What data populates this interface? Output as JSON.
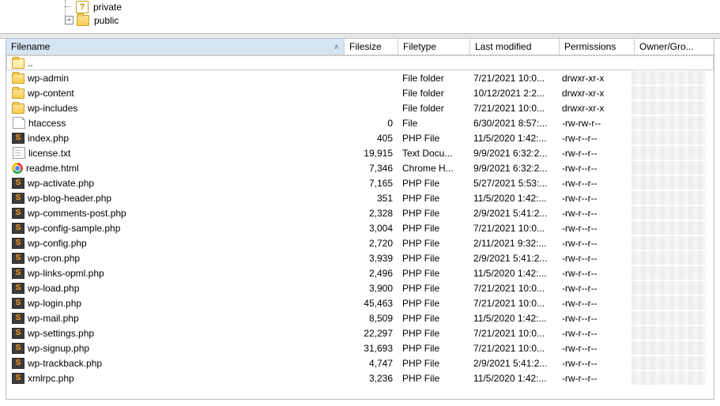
{
  "tree": {
    "items": [
      {
        "label": "private"
      },
      {
        "label": "public"
      }
    ]
  },
  "columns": [
    "Filename",
    "Filesize",
    "Filetype",
    "Last modified",
    "Permissions",
    "Owner/Gro..."
  ],
  "files": [
    {
      "icon": "up",
      "name": "..",
      "size": "",
      "type": "",
      "modified": "",
      "perm": "",
      "owner": "",
      "up": true
    },
    {
      "icon": "folder",
      "name": "wp-admin",
      "size": "",
      "type": "File folder",
      "modified": "7/21/2021 10:0...",
      "perm": "drwxr-xr-x",
      "owner": " "
    },
    {
      "icon": "folder",
      "name": "wp-content",
      "size": "",
      "type": "File folder",
      "modified": "10/12/2021 2:2...",
      "perm": "drwxr-xr-x",
      "owner": " "
    },
    {
      "icon": "folder",
      "name": "wp-includes",
      "size": "",
      "type": "File folder",
      "modified": "7/21/2021 10:0...",
      "perm": "drwxr-xr-x",
      "owner": " "
    },
    {
      "icon": "file",
      "name": "htaccess",
      "size": "0",
      "type": "File",
      "modified": "6/30/2021 8:57:...",
      "perm": "-rw-rw-r--",
      "owner": " "
    },
    {
      "icon": "php",
      "name": "index.php",
      "size": "405",
      "type": "PHP File",
      "modified": "11/5/2020 1:42:...",
      "perm": "-rw-r--r--",
      "owner": " "
    },
    {
      "icon": "txt",
      "name": "license.txt",
      "size": "19,915",
      "type": "Text Docu...",
      "modified": "9/9/2021 6:32:2...",
      "perm": "-rw-r--r--",
      "owner": " "
    },
    {
      "icon": "chrome",
      "name": "readme.html",
      "size": "7,346",
      "type": "Chrome H...",
      "modified": "9/9/2021 6:32:2...",
      "perm": "-rw-r--r--",
      "owner": " "
    },
    {
      "icon": "php",
      "name": "wp-activate.php",
      "size": "7,165",
      "type": "PHP File",
      "modified": "5/27/2021 5:53:...",
      "perm": "-rw-r--r--",
      "owner": " "
    },
    {
      "icon": "php",
      "name": "wp-blog-header.php",
      "size": "351",
      "type": "PHP File",
      "modified": "11/5/2020 1:42:...",
      "perm": "-rw-r--r--",
      "owner": " "
    },
    {
      "icon": "php",
      "name": "wp-comments-post.php",
      "size": "2,328",
      "type": "PHP File",
      "modified": "2/9/2021 5:41:2...",
      "perm": "-rw-r--r--",
      "owner": " "
    },
    {
      "icon": "php",
      "name": "wp-config-sample.php",
      "size": "3,004",
      "type": "PHP File",
      "modified": "7/21/2021 10:0...",
      "perm": "-rw-r--r--",
      "owner": " "
    },
    {
      "icon": "php",
      "name": "wp-config.php",
      "size": "2,720",
      "type": "PHP File",
      "modified": "2/11/2021 9:32:...",
      "perm": "-rw-r--r--",
      "owner": " "
    },
    {
      "icon": "php",
      "name": "wp-cron.php",
      "size": "3,939",
      "type": "PHP File",
      "modified": "2/9/2021 5:41:2...",
      "perm": "-rw-r--r--",
      "owner": " "
    },
    {
      "icon": "php",
      "name": "wp-links-opml.php",
      "size": "2,496",
      "type": "PHP File",
      "modified": "11/5/2020 1:42:...",
      "perm": "-rw-r--r--",
      "owner": " "
    },
    {
      "icon": "php",
      "name": "wp-load.php",
      "size": "3,900",
      "type": "PHP File",
      "modified": "7/21/2021 10:0...",
      "perm": "-rw-r--r--",
      "owner": " "
    },
    {
      "icon": "php",
      "name": "wp-login.php",
      "size": "45,463",
      "type": "PHP File",
      "modified": "7/21/2021 10:0...",
      "perm": "-rw-r--r--",
      "owner": " "
    },
    {
      "icon": "php",
      "name": "wp-mail.php",
      "size": "8,509",
      "type": "PHP File",
      "modified": "11/5/2020 1:42:...",
      "perm": "-rw-r--r--",
      "owner": " "
    },
    {
      "icon": "php",
      "name": "wp-settings.php",
      "size": "22,297",
      "type": "PHP File",
      "modified": "7/21/2021 10:0...",
      "perm": "-rw-r--r--",
      "owner": " "
    },
    {
      "icon": "php",
      "name": "wp-signup.php",
      "size": "31,693",
      "type": "PHP File",
      "modified": "7/21/2021 10:0...",
      "perm": "-rw-r--r--",
      "owner": " "
    },
    {
      "icon": "php",
      "name": "wp-trackback.php",
      "size": "4,747",
      "type": "PHP File",
      "modified": "2/9/2021 5:41:2...",
      "perm": "-rw-r--r--",
      "owner": " "
    },
    {
      "icon": "php",
      "name": "xmlrpc.php",
      "size": "3,236",
      "type": "PHP File",
      "modified": "11/5/2020 1:42:...",
      "perm": "-rw-r--r--",
      "owner": " "
    }
  ]
}
